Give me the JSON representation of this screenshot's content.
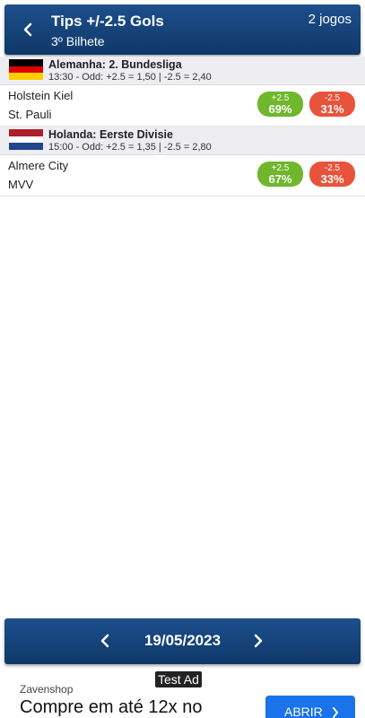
{
  "header": {
    "title": "Tips +/-2.5 Gols",
    "subtitle": "3º Bilhete",
    "count": "2 jogos",
    "back_icon": "chevron-left-icon"
  },
  "leagues": [
    {
      "name": "Alemanha: 2. Bundesliga",
      "info": "13:30 - Odd: +2.5 = 1,50 | -2.5 = 2,40",
      "flag": [
        "#000000",
        "#dd0000",
        "#ffce00"
      ],
      "match": {
        "home": "Holstein Kiel",
        "away": "St. Pauli",
        "over_label": "+2.5",
        "over_value": "69%",
        "under_label": "-2.5",
        "under_value": "31%"
      }
    },
    {
      "name": "Holanda: Eerste Divisie",
      "info": "15:00 - Odd: +2.5 = 1,35 | -2.5 = 2,80",
      "flag": [
        "#ae1c28",
        "#ffffff",
        "#21468b"
      ],
      "match": {
        "home": "Almere City",
        "away": "MVV",
        "over_label": "+2.5",
        "over_value": "67%",
        "under_label": "-2.5",
        "under_value": "33%"
      }
    }
  ],
  "date_bar": {
    "date": "19/05/2023",
    "prev_icon": "chevron-left-icon",
    "next_icon": "chevron-right-icon"
  },
  "ad": {
    "tag": "Test Ad",
    "brand": "Zavenshop",
    "headline": "Compre em até 12x no",
    "button": "ABRIR"
  },
  "colors": {
    "header_bg": "#1d4f8c",
    "over": "#6fb72c",
    "under": "#e9533b",
    "ad_button": "#1a73e8"
  }
}
